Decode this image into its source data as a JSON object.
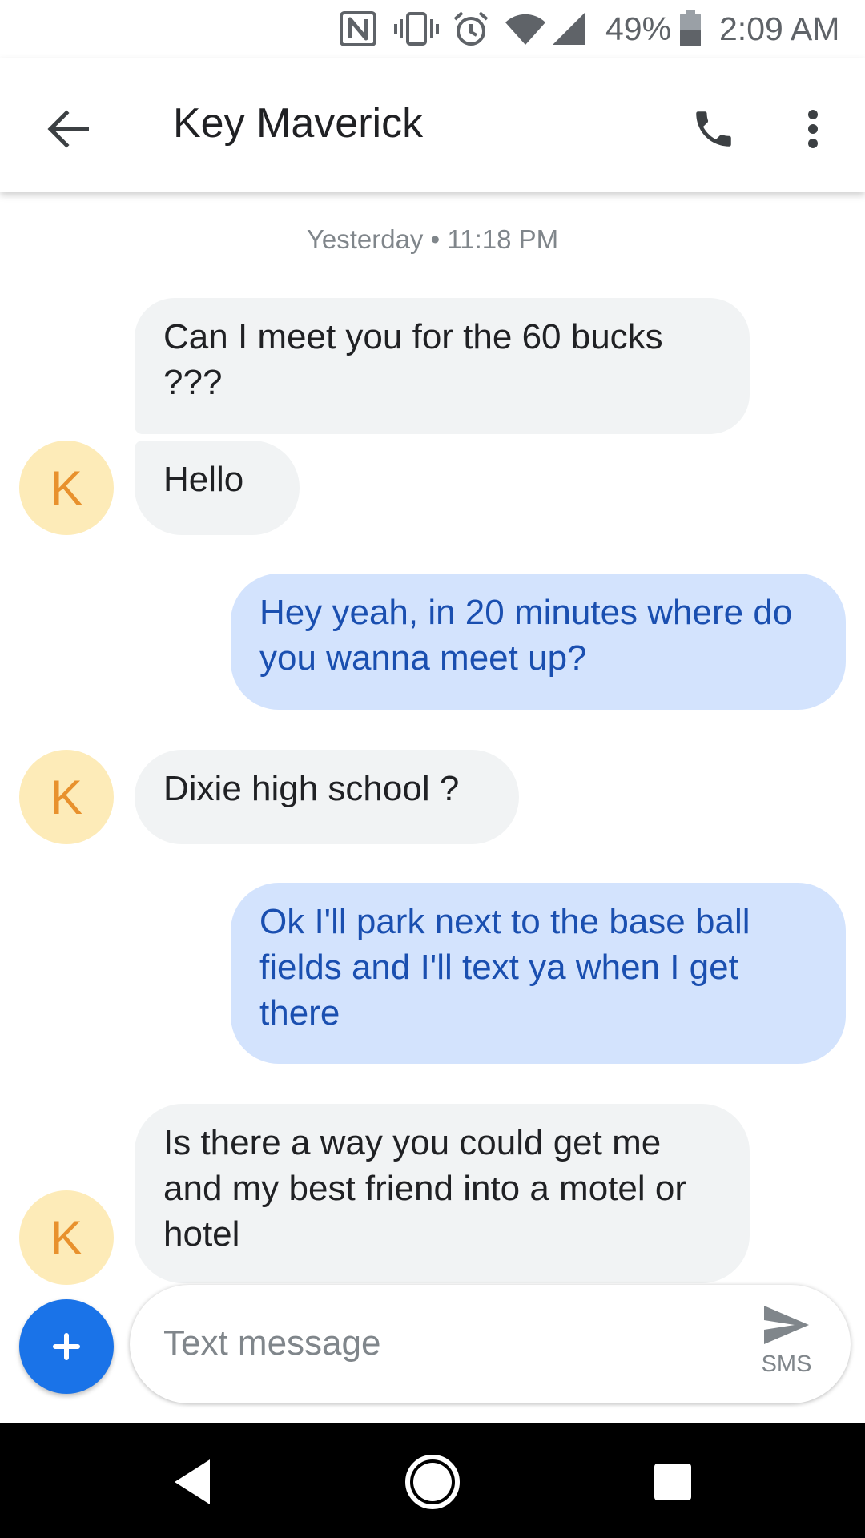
{
  "status_bar": {
    "battery_percent": "49%",
    "time": "2:09 AM",
    "icons": [
      "nfc-icon",
      "vibrate-icon",
      "alarm-icon",
      "wifi-icon",
      "signal-icon",
      "battery-icon"
    ]
  },
  "header": {
    "contact_name": "Key Maverick",
    "icons": [
      "back-arrow-icon",
      "phone-icon",
      "more-vert-icon"
    ]
  },
  "conversation": {
    "timestamp": "Yesterday • 11:18 PM",
    "messages": [
      {
        "direction": "incoming",
        "text": "Can I meet you for the 60 bucks ???"
      },
      {
        "direction": "incoming",
        "text": "Hello",
        "avatar": "K"
      },
      {
        "direction": "outgoing",
        "text": "Hey yeah, in 20 minutes where do you wanna meet up?"
      },
      {
        "direction": "incoming",
        "text": "Dixie high school ?",
        "avatar": "K"
      },
      {
        "direction": "outgoing",
        "text": "Ok I'll park next to the base ball fields and I'll text ya when I get there"
      },
      {
        "direction": "incoming",
        "text": "Is there a way you could get me and my best friend into a motel or hotel",
        "avatar": "K"
      }
    ]
  },
  "compose": {
    "placeholder": "Text message",
    "send_mode": "SMS",
    "icons": [
      "add-icon",
      "send-icon"
    ]
  },
  "nav_bar": {
    "icons": [
      "nav-back-icon",
      "nav-home-icon",
      "nav-recents-icon"
    ]
  },
  "colors": {
    "incoming_bubble": "#f1f3f4",
    "outgoing_bubble": "#d3e3fd",
    "outgoing_text": "#1a4fb0",
    "avatar_bg": "#fdebb8",
    "avatar_text": "#e8912d",
    "accent": "#1a73e8"
  }
}
